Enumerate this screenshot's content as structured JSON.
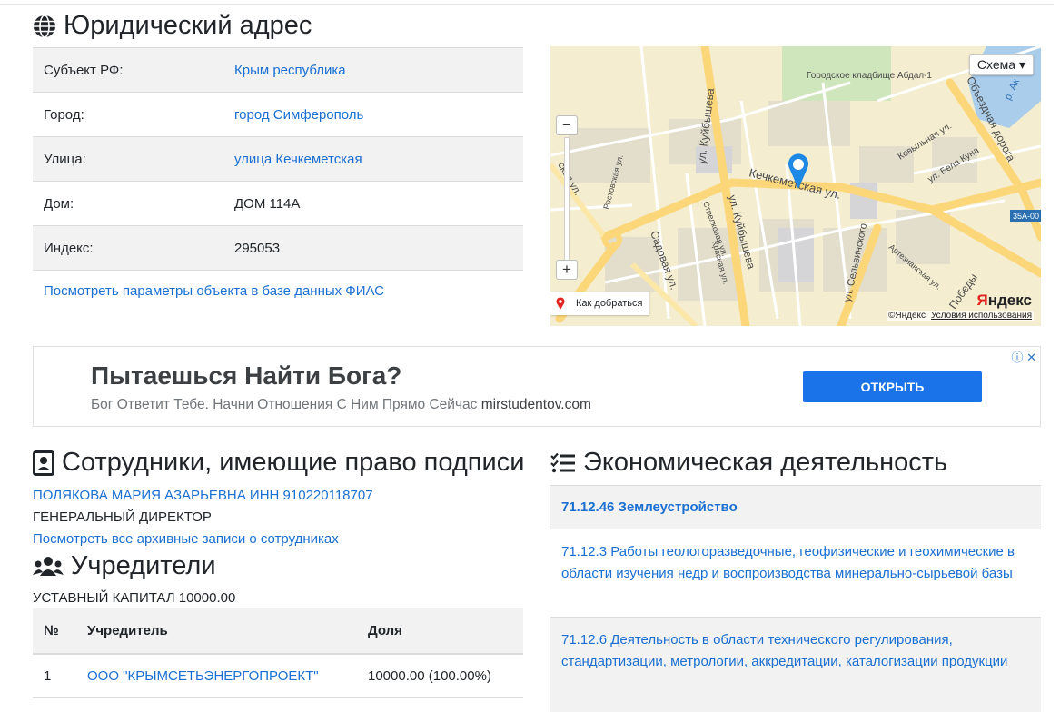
{
  "legal_address": {
    "title": "Юридический адрес",
    "rows": [
      {
        "label": "Субъект РФ:",
        "value": "Крым республика",
        "link": true
      },
      {
        "label": "Город:",
        "value": "город Симферополь",
        "link": true
      },
      {
        "label": "Улица:",
        "value": "улица Кечкеметская",
        "link": true
      },
      {
        "label": "Дом:",
        "value": "ДОМ 114А",
        "link": false
      },
      {
        "label": "Индекс:",
        "value": "295053",
        "link": false
      }
    ],
    "fias_link": "Посмотреть параметры объекта в базе данных ФИАС"
  },
  "map": {
    "layer_button": "Схема ▾",
    "route_label": "Как добраться",
    "copyright": "©Яндекс",
    "terms": "Условия использования",
    "logo_y": "Я",
    "logo_rest": "ндекс",
    "labels": {
      "cemetery": "Городское кладбище Абдал-1",
      "kuybysheva1": "ул. Куйбышева",
      "kuybysheva2": "ул. Куйбышева",
      "kechkemetskaya": "Кечкеметская ул.",
      "obezdnaya": "Объездная дорога",
      "kovylnaya": "Ковыльная ул.",
      "bela_kuna": "ул. Бела Куна",
      "rostovskaya": "Ростовская ул.",
      "strelkovaya": "Стрелковая ул.",
      "sadovaya": "Садовая ул.",
      "krasnaya": "Красная ул.",
      "selvinskogo": "ул. Сельвинского",
      "artezianskaya": "Артезианская ул.",
      "pobedy": "Победы",
      "road_code": "35А-00",
      "left_street": "ская ул.",
      "river": "р. Ак"
    }
  },
  "ad": {
    "headline": "Пытаешься Найти Бога?",
    "text": "Бог Ответит Тебе. Начни Отношения С Ним Прямо Сейчас",
    "domain": "mirstudentov.com",
    "button": "ОТКРЫТЬ",
    "icons": "ⓘ ✕"
  },
  "employees": {
    "title": "Сотрудники, имеющие право подписи",
    "name": "ПОЛЯКОВА МАРИЯ АЗАРЬЕВНА ИНН 910220118707",
    "role": "ГЕНЕРАЛЬНЫЙ ДИРЕКТОР",
    "archive_link": "Посмотреть все архивные записи о сотрудниках"
  },
  "founders": {
    "title": "Учредители",
    "capital": "УСТАВНЫЙ КАПИТАЛ 10000.00",
    "headers": [
      "№",
      "Учредитель",
      "Доля"
    ],
    "rows": [
      {
        "num": "1",
        "name": "ООО \"КРЫМСЕТЬЭНЕРГОПРОЕКТ\"",
        "share": "10000.00 (100.00%)"
      }
    ]
  },
  "economic": {
    "title": "Экономическая деятельность",
    "items": [
      "71.12.46 Землеустройство",
      "71.12.3 Работы геологоразведочные, геофизические и геохимические в области изучения недр и воспроизводства минерально-сырьевой базы",
      "71.12.6 Деятельность в области технического регулирования, стандартизации, метрологии, аккредитации, каталогизации продукции"
    ]
  }
}
